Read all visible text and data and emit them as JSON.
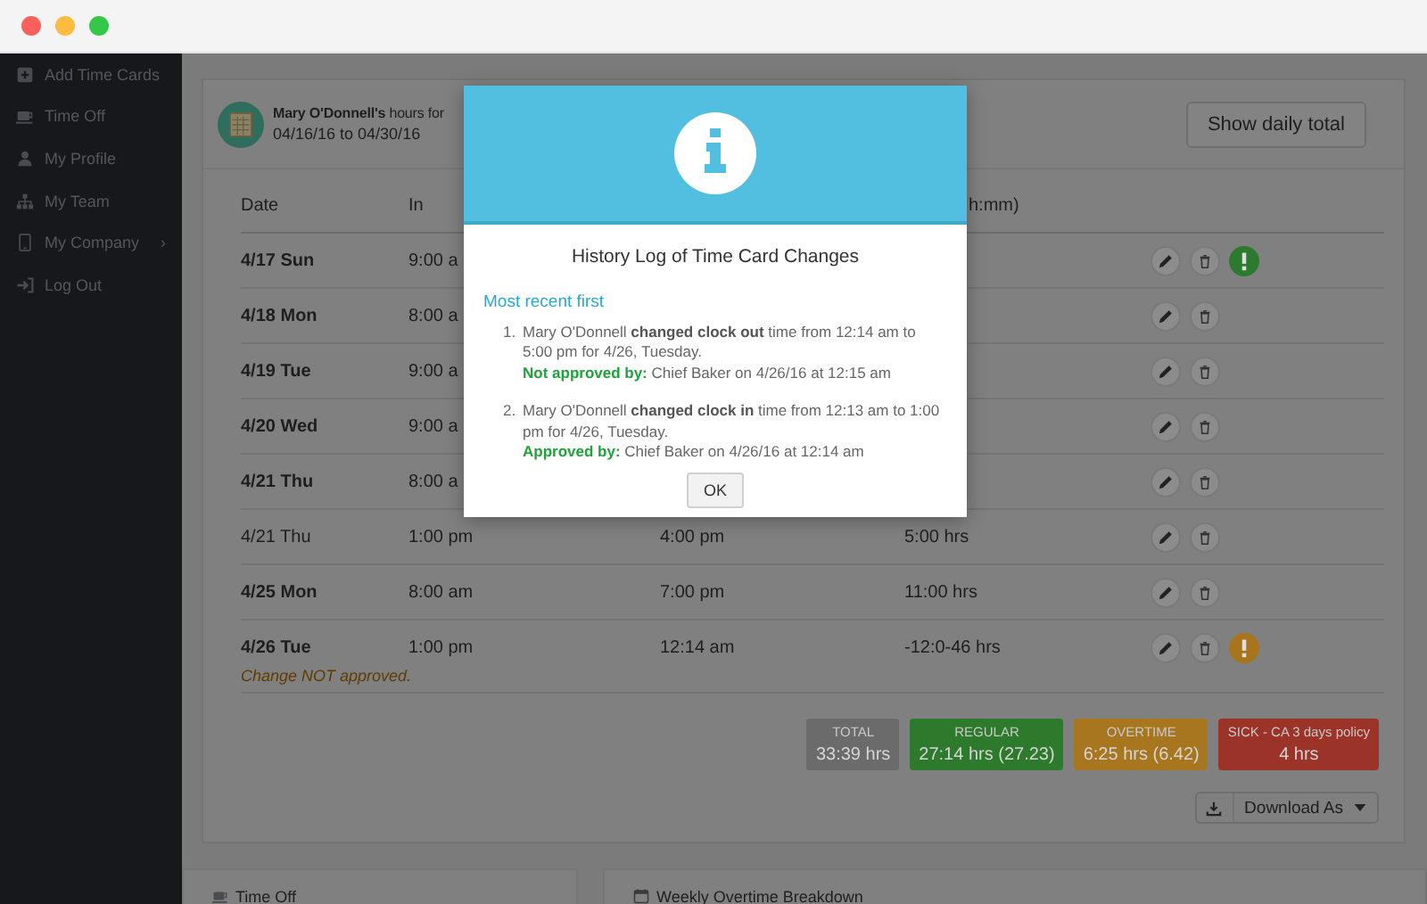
{
  "sidebar": {
    "items": [
      {
        "label": "Add Time Cards",
        "submenu": false
      },
      {
        "label": "Time Off",
        "submenu": false
      },
      {
        "label": "My Profile",
        "submenu": false
      },
      {
        "label": "My Team",
        "submenu": false
      },
      {
        "label": "My Company",
        "submenu": true
      },
      {
        "label": "Log Out",
        "submenu": false
      }
    ],
    "submenu_arrow": "›"
  },
  "timecard": {
    "title": "**Mary O'Donnell's** hours for",
    "period": "04/16/16 to 04/30/16",
    "daily_total_button": "Show daily total",
    "columns": [
      {
        "label": "Date"
      },
      {
        "label": "In"
      },
      {},
      {
        "label": "h:mm)"
      }
    ],
    "rows": [
      {
        "date": "4/17 Sun",
        "bold": true,
        "in": "9:00 a",
        "alert": {
          "color": "#2b7a2e"
        }
      },
      {
        "date": "4/18 Mon",
        "bold": true,
        "in": "8:00 a"
      },
      {
        "date": "4/19 Tue",
        "bold": true,
        "in": "9:00 a"
      },
      {
        "date": "4/20 Wed",
        "bold": true,
        "in": "9:00 a"
      },
      {
        "date": "4/21 Thu",
        "bold": true,
        "in": "8:00 a"
      },
      {
        "date": "4/21 Thu",
        "bold": false,
        "in": "1:00 pm",
        "out": "4:00 pm",
        "hours": "5:00 hrs"
      },
      {
        "date": "4/25 Mon",
        "bold": true,
        "in": "8:00 am",
        "out": "7:00 pm",
        "hours": "11:00 hrs"
      },
      {
        "date": "4/26 Tue",
        "bold": true,
        "in": "1:00 pm",
        "out": "12:14 am",
        "hours": "-12:0-46 hrs",
        "alert": {
          "color": "#a8751c"
        },
        "note": "Change NOT approved."
      }
    ],
    "totals": [
      {
        "label": "TOTAL",
        "value": "33:39 hrs",
        "color": "#6b6b6b"
      },
      {
        "label": "REGULAR",
        "value": "27:14 hrs (27.23)",
        "color": "#2d7a2d"
      },
      {
        "label": "OVERTIME",
        "value": "6:25 hrs (6.42)",
        "color": "#a8761e"
      },
      {
        "label": "SICK - CA 3 days policy",
        "value": "4 hrs",
        "color": "#9c3328"
      }
    ],
    "download_button": "Download As"
  },
  "bottom_panels": [
    {
      "label": "Time Off"
    },
    {
      "label": "Weekly Overtime Breakdown"
    }
  ],
  "modal": {
    "title": "History Log of Time Card Changes",
    "subtitle": "Most recent first",
    "entries": [
      {
        "number": "1.",
        "text": "Mary O'Donnell **changed clock out** time from 12:14 am to 5:00 pm for 4/26, Tuesday.",
        "approval_label": "Not approved by:",
        "approval_text": "Chief Baker on 4/26/16 at 12:15 am"
      },
      {
        "number": "2.",
        "text": "Mary O'Donnell **changed clock in** time from 12:13 am to 1:00 pm for 4/26, Tuesday.",
        "approval_label": "Approved by:",
        "approval_text": "Chief Baker on 4/26/16 at 12:14 am"
      }
    ],
    "ok_button": "OK"
  }
}
